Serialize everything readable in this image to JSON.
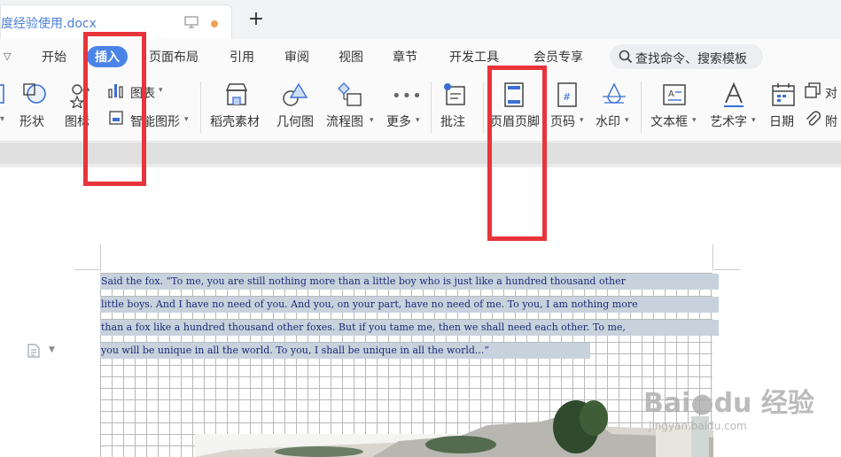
{
  "tab": {
    "title": "度经验使用.docx",
    "new_tab_label": "+"
  },
  "menu": {
    "items": [
      "开始",
      "插入",
      "页面布局",
      "引用",
      "审阅",
      "视图",
      "章节",
      "开发工具",
      "会员专享"
    ],
    "active": "插入",
    "search_label": "查找命令、搜索模板"
  },
  "ribbon": {
    "shape": "形状",
    "icon": "图标",
    "chart": "图表",
    "smartart": "智能图形",
    "docer": "稻壳素材",
    "geometry": "几何图",
    "flowchart": "流程图",
    "more": "更多",
    "comment": "批注",
    "header_footer": "页眉页脚",
    "page_number": "页码",
    "watermark": "水印",
    "textbox": "文本框",
    "wordart": "艺术字",
    "date": "日期",
    "object": "对",
    "attachment": "附"
  },
  "document": {
    "lines": [
      "Said the fox. “To me, you are still nothing more than a little boy who is just like a hundred thousand other",
      "little boys. And I have no need of you. And you, on your part, have no need of me. To you, I am nothing more",
      "than a fox like a hundred thousand other foxes. But if you tame me, then we shall need each other. To me,",
      "you will be unique in all the world. To you, I shall be unique in all the world...”"
    ]
  },
  "watermark": {
    "main": "Bai●du 经验",
    "sub": "jingyan.baidu.com"
  },
  "colors": {
    "accent": "#4a84e9",
    "highlight_box": "#e8343a",
    "selection": "#c7d2dc",
    "tab_title": "#4a7fd8"
  }
}
